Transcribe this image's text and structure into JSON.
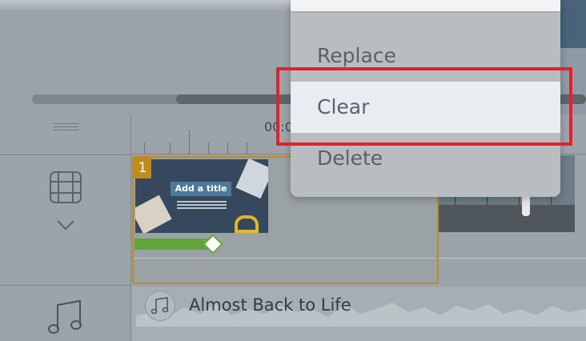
{
  "menu": {
    "items": [
      {
        "label": "Replace"
      },
      {
        "label": "Clear"
      },
      {
        "label": "Delete"
      }
    ]
  },
  "timeline": {
    "ruler_time": "00:0",
    "clip_number": "1",
    "clip_thumbnail_title": "Add a title"
  },
  "audio": {
    "title": "Almost Back to Life"
  },
  "colors": {
    "clip_border": "#c18a1d",
    "keyframe_bar": "#63a43a",
    "highlight": "#e3202b",
    "menu_hover": "#e9ecf0"
  },
  "icons": [
    "film-strip-icon",
    "chevron-down-icon",
    "music-note-icon",
    "drag-handle-icon"
  ]
}
